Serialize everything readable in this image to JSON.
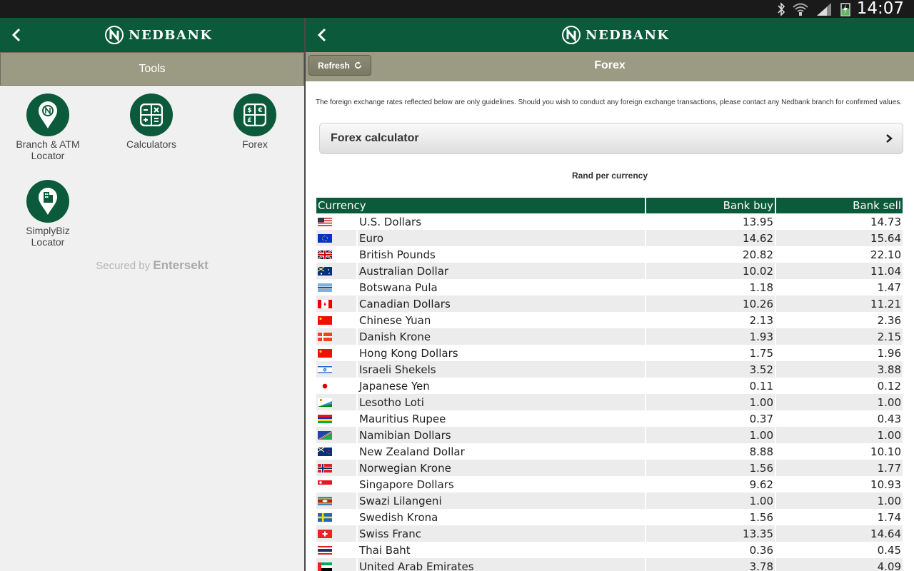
{
  "status_bar": {
    "time": "14:07"
  },
  "left_panel": {
    "brand": "NEDBANK",
    "section_title": "Tools",
    "tiles": [
      {
        "label_line1": "Branch & ATM",
        "label_line2": "Locator",
        "icon": "map-pin-icon"
      },
      {
        "label_line1": "Calculators",
        "label_line2": "",
        "icon": "calculator-icon"
      },
      {
        "label_line1": "Forex",
        "label_line2": "",
        "icon": "forex-calculator-icon"
      },
      {
        "label_line1": "SimplyBiz",
        "label_line2": "Locator",
        "icon": "building-pin-icon"
      }
    ],
    "secured_prefix": "Secured by",
    "secured_brand": "Entersekt"
  },
  "right_panel": {
    "brand": "NEDBANK",
    "refresh_label": "Refresh",
    "title": "Forex",
    "disclaimer": "The foreign exchange rates reflected below are only guidelines. Should you wish to conduct any foreign exchange transactions, please contact any Nedbank branch for confirmed values.",
    "calculator_label": "Forex calculator",
    "rand_caption": "Rand per currency",
    "table": {
      "headers": [
        "Currency",
        "Bank buy",
        "Bank sell"
      ],
      "rows": [
        {
          "flag": "us",
          "name": "U.S. Dollars",
          "buy": "13.95",
          "sell": "14.73"
        },
        {
          "flag": "eu",
          "name": "Euro",
          "buy": "14.62",
          "sell": "15.64"
        },
        {
          "flag": "gb",
          "name": "British Pounds",
          "buy": "20.82",
          "sell": "22.10"
        },
        {
          "flag": "au",
          "name": "Australian Dollar",
          "buy": "10.02",
          "sell": "11.04"
        },
        {
          "flag": "bw",
          "name": "Botswana Pula",
          "buy": "1.18",
          "sell": "1.47"
        },
        {
          "flag": "ca",
          "name": "Canadian Dollars",
          "buy": "10.26",
          "sell": "11.21"
        },
        {
          "flag": "cn",
          "name": "Chinese Yuan",
          "buy": "2.13",
          "sell": "2.36"
        },
        {
          "flag": "dk",
          "name": "Danish Krone",
          "buy": "1.93",
          "sell": "2.15"
        },
        {
          "flag": "hk",
          "name": "Hong Kong Dollars",
          "buy": "1.75",
          "sell": "1.96"
        },
        {
          "flag": "il",
          "name": "Israeli Shekels",
          "buy": "3.52",
          "sell": "3.88"
        },
        {
          "flag": "jp",
          "name": "Japanese Yen",
          "buy": "0.11",
          "sell": "0.12"
        },
        {
          "flag": "ls",
          "name": "Lesotho Loti",
          "buy": "1.00",
          "sell": "1.00"
        },
        {
          "flag": "mu",
          "name": "Mauritius Rupee",
          "buy": "0.37",
          "sell": "0.43"
        },
        {
          "flag": "na",
          "name": "Namibian Dollars",
          "buy": "1.00",
          "sell": "1.00"
        },
        {
          "flag": "nz",
          "name": "New Zealand Dollar",
          "buy": "8.88",
          "sell": "10.10"
        },
        {
          "flag": "no",
          "name": "Norwegian Krone",
          "buy": "1.56",
          "sell": "1.77"
        },
        {
          "flag": "sg",
          "name": "Singapore Dollars",
          "buy": "9.62",
          "sell": "10.93"
        },
        {
          "flag": "sz",
          "name": "Swazi Lilangeni",
          "buy": "1.00",
          "sell": "1.00"
        },
        {
          "flag": "se",
          "name": "Swedish Krona",
          "buy": "1.56",
          "sell": "1.74"
        },
        {
          "flag": "ch",
          "name": "Swiss Franc",
          "buy": "13.35",
          "sell": "14.64"
        },
        {
          "flag": "th",
          "name": "Thai Baht",
          "buy": "0.36",
          "sell": "0.45"
        },
        {
          "flag": "ae",
          "name": "United Arab Emirates",
          "buy": "3.78",
          "sell": "4.09"
        }
      ]
    }
  },
  "colors": {
    "brand_green": "#0b5a3c",
    "khaki_bar": "#9b9a83",
    "row_alt": "#ececec"
  }
}
